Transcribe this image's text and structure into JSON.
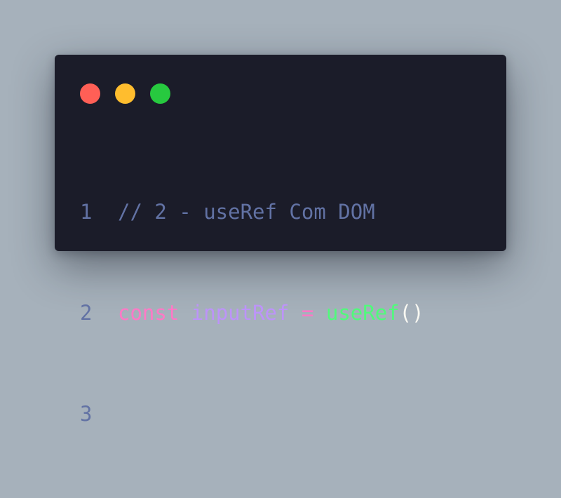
{
  "colors": {
    "background": "#a6b1bb",
    "window": "#1b1c29",
    "close": "#ff5f56",
    "minimize": "#ffbd2e",
    "maximize": "#27c93f",
    "line_number": "#6272a4",
    "comment": "#6272a4",
    "keyword": "#ff79c6",
    "variable": "#bd93f9",
    "operator": "#ff79c6",
    "function": "#50fa7b",
    "punctuation": "#f8f8f2"
  },
  "controls": [
    {
      "name": "close-dot",
      "color": "#ff5f56"
    },
    {
      "name": "minimize-dot",
      "color": "#ffbd2e"
    },
    {
      "name": "maximize-dot",
      "color": "#27c93f"
    }
  ],
  "code": {
    "lines": [
      {
        "number": "1",
        "tokens": [
          {
            "text": "// 2 - useRef Com DOM",
            "kind": "comment"
          }
        ]
      },
      {
        "number": "2",
        "tokens": [
          {
            "text": "const",
            "kind": "keyword"
          },
          {
            "text": " ",
            "kind": "space"
          },
          {
            "text": "inputRef",
            "kind": "variable"
          },
          {
            "text": " ",
            "kind": "space"
          },
          {
            "text": "=",
            "kind": "operator"
          },
          {
            "text": " ",
            "kind": "space"
          },
          {
            "text": "useRef",
            "kind": "function"
          },
          {
            "text": "()",
            "kind": "punctuation"
          }
        ]
      },
      {
        "number": "3",
        "tokens": []
      }
    ]
  }
}
